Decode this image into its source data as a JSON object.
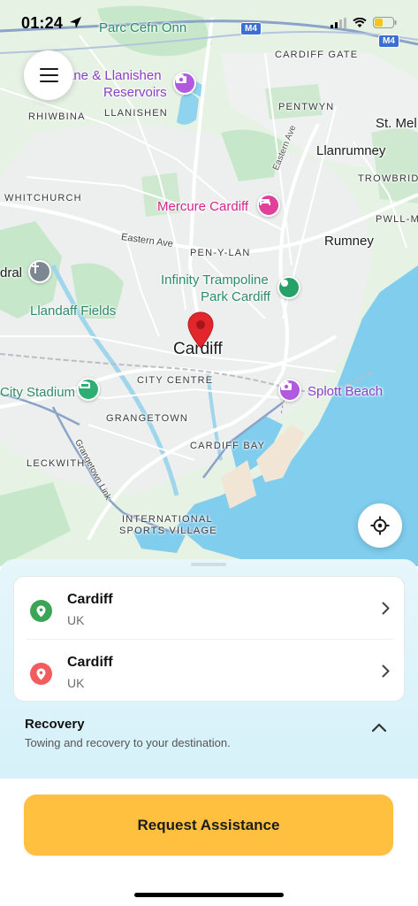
{
  "status_bar": {
    "time": "01:24",
    "battery_color": "#f5c518"
  },
  "map": {
    "road_shields": [
      "M4",
      "M4"
    ],
    "labels": {
      "parc_cefn_onn": "Parc Cefn Onn",
      "cardiff_gate": "CARDIFF GATE",
      "reservoirs_line1": "ane & Llanishen",
      "reservoirs_line2": "Reservoirs",
      "rhiwbina": "RHIWBINA",
      "llanishen": "LLANISHEN",
      "pentwyn": "PENTWYN",
      "st_mel": "St. Mel",
      "llanrumney": "Llanrumney",
      "eastern_ave_1": "Eastern Ave",
      "trowbridge": "TROWBRIDGE",
      "whitchurch": "WHITCHURCH",
      "mercure": "Mercure Cardiff",
      "pwll_ma": "PWLL-MA",
      "eastern_ave_2": "Eastern Ave",
      "pen_y_lan": "PEN-Y-LAN",
      "rumney": "Rumney",
      "dral": "dral",
      "infinity_line1": "Infinity Trampoline",
      "infinity_line2": "Park Cardiff",
      "llandaff_fields": "Llandaff Fields",
      "cardiff": "Cardiff",
      "city_stadium": "City Stadium",
      "city_centre": "CITY CENTRE",
      "splott_beach": "Splott Beach",
      "grangetown": "GRANGETOWN",
      "grangetown_link": "Grangetown Link",
      "leckwith": "LECKWITH",
      "cardiff_bay": "CARDIFF BAY",
      "isv_line1": "INTERNATIONAL",
      "isv_line2": "SPORTS VILLAGE"
    },
    "poi_icons": [
      "camera-icon",
      "hotel-icon",
      "church-icon",
      "attraction-icon",
      "stadium-icon",
      "camera-icon"
    ],
    "colors": {
      "land": "#e4f2e4",
      "park": "#c3e6c7",
      "water": "#7fcdec",
      "road": "#ffffff",
      "motorway": "#8aa3c7",
      "pin": "#e2262b"
    }
  },
  "menu_icon": "hamburger-icon",
  "locate_icon": "crosshair-icon",
  "locations": [
    {
      "title": "Cardiff",
      "subtitle": "UK",
      "icon": "pin-icon",
      "color": "#3aa655"
    },
    {
      "title": "Cardiff",
      "subtitle": "UK",
      "icon": "pin-icon",
      "color": "#f25c5c"
    }
  ],
  "service": {
    "title": "Recovery",
    "description": "Towing and recovery to your destination."
  },
  "cta": {
    "label": "Request Assistance",
    "color": "#ffbf3f"
  }
}
